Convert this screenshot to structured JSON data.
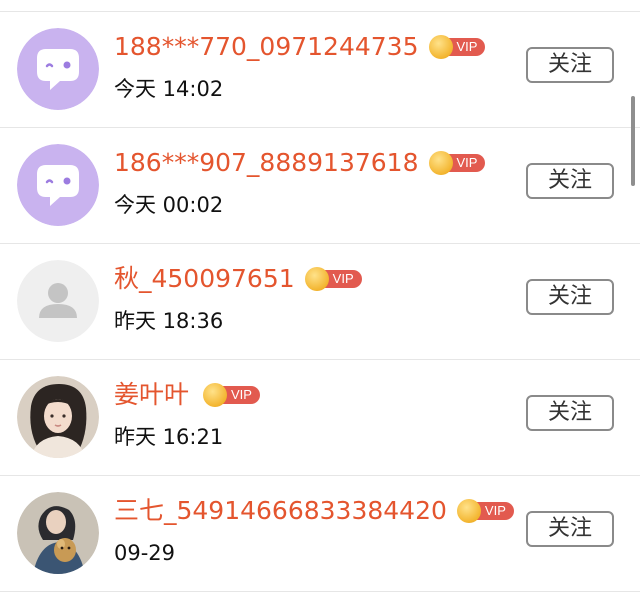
{
  "follow_label": "关注",
  "vip_label": "VIP",
  "colors": {
    "name": "#e4552e",
    "vip_badge": "#e25a4f",
    "crown": "#f3b52f",
    "default_avatar_bg": "#c9b3ef"
  },
  "users": [
    {
      "name": "188***770_0971244735",
      "time": "今天 14:02",
      "avatar": "default-chat-bubble-avatar",
      "vip": true
    },
    {
      "name": "186***907_8889137618",
      "time": "今天 00:02",
      "avatar": "default-chat-bubble-avatar",
      "vip": true
    },
    {
      "name": "秋_450097651",
      "time": "昨天 18:36",
      "avatar": "placeholder-person-avatar",
      "vip": true
    },
    {
      "name": "姜叶叶",
      "time": "昨天 16:21",
      "avatar": "photo-girl-avatar",
      "vip": true
    },
    {
      "name": "三七_54914666833384420",
      "time": "09-29",
      "avatar": "photo-person-with-dog-avatar",
      "vip": true
    }
  ]
}
